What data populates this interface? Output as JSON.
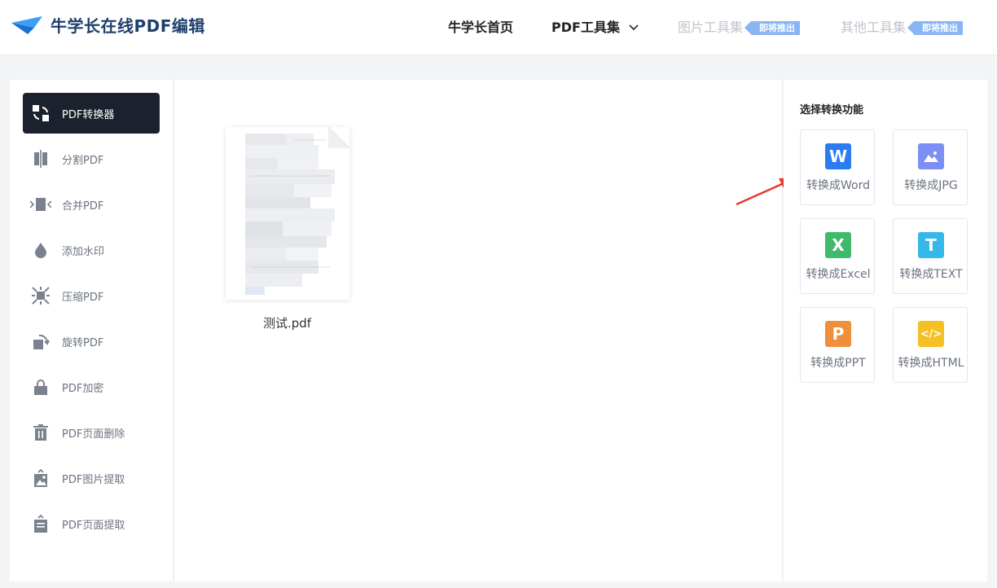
{
  "header": {
    "logo_text": "牛学长在线PDF编辑",
    "nav": {
      "home": "牛学长首页",
      "pdf_tools": "PDF工具集",
      "image_tools": "图片工具集",
      "other_tools": "其他工具集",
      "coming_soon": "即将推出"
    }
  },
  "sidebar": {
    "items": [
      {
        "label": "PDF转换器",
        "icon": "convert-icon",
        "active": true
      },
      {
        "label": "分割PDF",
        "icon": "split-icon"
      },
      {
        "label": "合并PDF",
        "icon": "merge-icon"
      },
      {
        "label": "添加水印",
        "icon": "watermark-drop-icon"
      },
      {
        "label": "压缩PDF",
        "icon": "compress-icon"
      },
      {
        "label": "旋转PDF",
        "icon": "rotate-icon"
      },
      {
        "label": "PDF加密",
        "icon": "lock-icon"
      },
      {
        "label": "PDF页面删除",
        "icon": "trash-icon"
      },
      {
        "label": "PDF图片提取",
        "icon": "image-extract-icon"
      },
      {
        "label": "PDF页面提取",
        "icon": "page-extract-icon"
      }
    ]
  },
  "main": {
    "file_name": "测试.pdf"
  },
  "panel": {
    "title": "选择转换功能",
    "options": [
      {
        "label": "转换成Word",
        "glyph": "W",
        "color": "#2b7cf0"
      },
      {
        "label": "转换成JPG",
        "glyph": "",
        "color": "#7b8ff5"
      },
      {
        "label": "转换成Excel",
        "glyph": "X",
        "color": "#3fba6a"
      },
      {
        "label": "转换成TEXT",
        "glyph": "T",
        "color": "#35b8ea"
      },
      {
        "label": "转换成PPT",
        "glyph": "P",
        "color": "#ef8f3b"
      },
      {
        "label": "转换成HTML",
        "glyph": "</>",
        "color": "#f5c023"
      }
    ]
  },
  "colors": {
    "accent_dark": "#1c222d",
    "arrow_red": "#e8392c",
    "badge_blue": "#89b5f4"
  }
}
